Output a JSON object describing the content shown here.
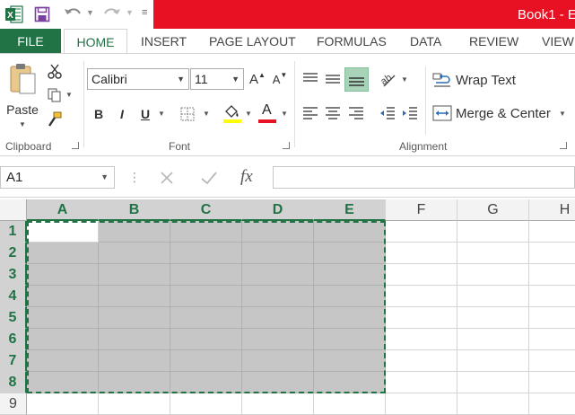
{
  "window": {
    "title": "Book1 - E",
    "titlebar_color": "#e81123",
    "accent_color": "#217346"
  },
  "qat": {
    "icons": [
      "excel-logo-icon",
      "save-icon",
      "undo-icon",
      "redo-icon",
      "customize-qat-icon"
    ]
  },
  "tabs": [
    {
      "label": "FILE"
    },
    {
      "label": "HOME"
    },
    {
      "label": "INSERT"
    },
    {
      "label": "PAGE LAYOUT"
    },
    {
      "label": "FORMULAS"
    },
    {
      "label": "DATA"
    },
    {
      "label": "REVIEW"
    },
    {
      "label": "VIEW"
    }
  ],
  "ribbon": {
    "clipboard": {
      "label": "Clipboard",
      "paste_label": "Paste"
    },
    "font": {
      "label": "Font",
      "font_name": "Calibri",
      "font_size": "11",
      "bold": "B",
      "italic": "I",
      "underline": "U",
      "font_color_letter": "A",
      "grow_letter": "A",
      "shrink_letter": "A"
    },
    "alignment": {
      "label": "Alignment",
      "wrap_text": "Wrap Text",
      "merge_center": "Merge & Center"
    }
  },
  "formula_bar": {
    "name_box": "A1",
    "fx_label": "fx",
    "value": ""
  },
  "grid": {
    "columns": [
      "A",
      "B",
      "C",
      "D",
      "E",
      "F",
      "G",
      "H"
    ],
    "rows": [
      "1",
      "2",
      "3",
      "4",
      "5",
      "6",
      "7",
      "8",
      "9"
    ],
    "selected_columns": [
      "A",
      "B",
      "C",
      "D",
      "E"
    ],
    "selected_rows": [
      "1",
      "2",
      "3",
      "4",
      "5",
      "6",
      "7",
      "8"
    ],
    "selection_range": "A1:E8",
    "active_cell": "A1"
  }
}
